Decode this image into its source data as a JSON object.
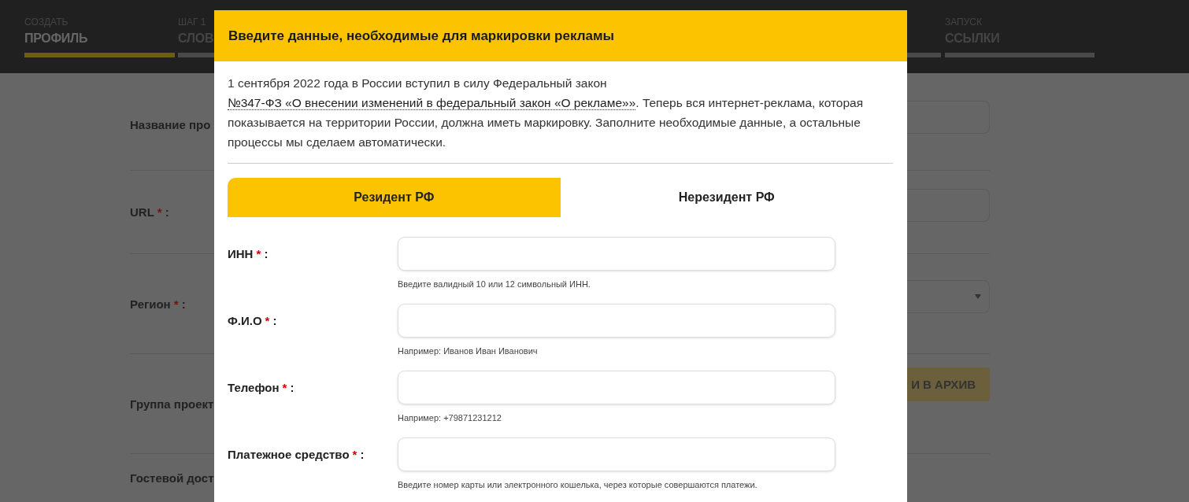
{
  "header": {
    "steps": [
      {
        "caption": "СОЗДАТЬ",
        "title": "ПРОФИЛЬ",
        "selected": true
      },
      {
        "caption": "ШАГ 1",
        "title": "СЛОВ",
        "selected": false
      },
      {
        "selected": false
      },
      {
        "caption": "ЗАПУСК",
        "title": "ССЫЛКИ",
        "selected": false
      }
    ]
  },
  "form": {
    "rows": [
      {
        "label": "Название про",
        "required": false,
        "field": {
          "kind": "input"
        }
      },
      {
        "label": "URL",
        "required": true,
        "asterisk": "*",
        "colon": ":",
        "field": {
          "kind": "input"
        }
      },
      {
        "label": "Регион",
        "required": true,
        "asterisk": "*",
        "colon": ":",
        "field": {
          "kind": "select"
        }
      },
      {
        "label": "Группа проект",
        "required": false,
        "field": {
          "kind": "button",
          "text": "И В АРХИВ"
        }
      },
      {
        "label": "Гостевой дост",
        "required": false,
        "field": {
          "kind": "none"
        }
      }
    ]
  },
  "modal": {
    "title": "Введите данные, необходимые для маркировки рекламы",
    "intro": {
      "before": "1 сентября 2022 года в России вступил в силу Федеральный закон ",
      "link": "№347-ФЗ «О внесении изменений в федеральный закон «О рекламе»»",
      "after": ". Теперь вся интернет-реклама, которая показывается на территории России, должна иметь маркировку. Заполните необходимые данные, а остальные процессы мы сделаем автоматически."
    },
    "tabs": [
      {
        "label": "Резидент РФ",
        "selected": true
      },
      {
        "label": "Нерезидент РФ",
        "selected": false
      }
    ],
    "fields": [
      {
        "label": "ИНН",
        "required": true,
        "asterisk": "*",
        "colon": ":",
        "hint": "Введите валидный 10 или 12 символьный ИНН."
      },
      {
        "label": "Ф.И.О",
        "required": true,
        "asterisk": "*",
        "colon": ":",
        "hint": "Например: Иванов Иван Иванович"
      },
      {
        "label": "Телефон",
        "required": true,
        "asterisk": "*",
        "colon": ":",
        "hint": "Например: +79871231212"
      },
      {
        "label": "Платежное средство",
        "required": true,
        "asterisk": "*",
        "colon": ":",
        "hint": "Введите номер карты или электронного кошелька, через которые совершаются платежи."
      }
    ]
  }
}
